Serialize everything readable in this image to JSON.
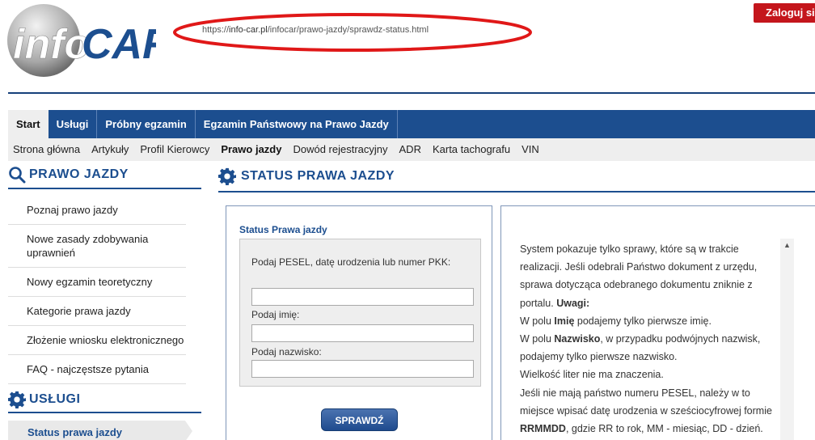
{
  "header": {
    "logo_text_info": "info",
    "logo_text_car": "CAR",
    "url_prefix": "https://",
    "url_domain": "info-car.pl",
    "url_path": "/infocar/prawo-jazdy/sprawdz-status.html",
    "login_label": "Zaloguj się"
  },
  "main_nav": {
    "tabs": [
      "Start",
      "Usługi",
      "Próbny egzamin",
      "Egzamin Państwowy na Prawo Jazdy"
    ]
  },
  "sub_nav": {
    "items": [
      "Strona główna",
      "Artykuły",
      "Profil Kierowcy",
      "Prawo jazdy",
      "Dowód rejestracyjny",
      "ADR",
      "Karta tachografu",
      "VIN"
    ]
  },
  "sidebar": {
    "heading": "PRAWO JAZDY",
    "items": [
      "Poznaj prawo jazdy",
      "Nowe zasady zdobywania uprawnień",
      "Nowy egzamin teoretyczny",
      "Kategorie prawa jazdy",
      "Złożenie wniosku elektronicznego",
      "FAQ - najczęstsze pytania"
    ],
    "services_heading": "USŁUGI",
    "active_service": "Status prawa jazdy"
  },
  "content": {
    "heading": "STATUS PRAWA JAZDY",
    "form": {
      "title": "Status Prawa jazdy",
      "pesel_label": "Podaj PESEL, datę urodzenia lub numer PKK:",
      "pesel_value": "",
      "name_label": "Podaj imię:",
      "name_value": "",
      "surname_label": "Podaj nazwisko:",
      "surname_value": "",
      "submit_label": "SPRAWDŹ"
    },
    "info": {
      "line1": "System pokazuje tylko sprawy, które są w trakcie realizacji. Jeśli odebrali Państwo dokument z urzędu, sprawa dotycząca odebranego dokumentu zniknie z portalu.",
      "uwagi": "Uwagi:",
      "line2_a": "W polu ",
      "line2_b": "Imię",
      "line2_c": " podajemy tylko pierwsze imię.",
      "line3_a": "W polu ",
      "line3_b": "Nazwisko",
      "line3_c": ", w przypadku podwójnych nazwisk, podajemy tylko pierwsze nazwisko.",
      "line4": "Wielkość liter nie ma znaczenia.",
      "line5_a": "Jeśli nie mają państwo numeru PESEL, należy w to miejsce wpisać datę urodzenia w sześciocyfrowej formie ",
      "line5_b": "RRMMDD",
      "line5_c": ", gdzie RR to rok, MM - miesiąc, DD - dzień."
    }
  },
  "colors": {
    "brand_blue": "#1c4e8f",
    "login_red": "#c4161c",
    "annotation_red": "#e01818"
  }
}
